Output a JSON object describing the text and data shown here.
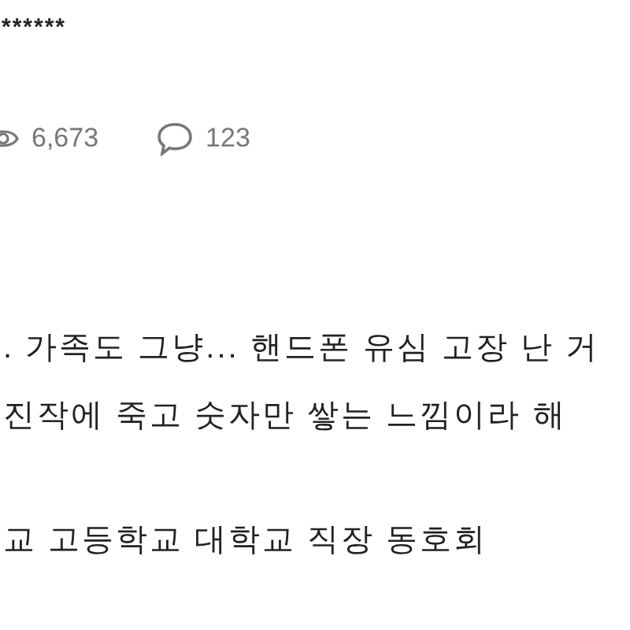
{
  "post_title_tail": "******",
  "stats": [
    {
      "kind": "views",
      "count": "6,673"
    },
    {
      "kind": "comments",
      "count": "123"
    }
  ],
  "paragraphs": [
    [
      ". 가족도 그냥... 핸드폰 유심 고장 난 거",
      "진작에 죽고 숫자만 쌓는 느낌이라 해"
    ],
    [
      "교 고등학교 대학교 직장 동호회"
    ]
  ]
}
